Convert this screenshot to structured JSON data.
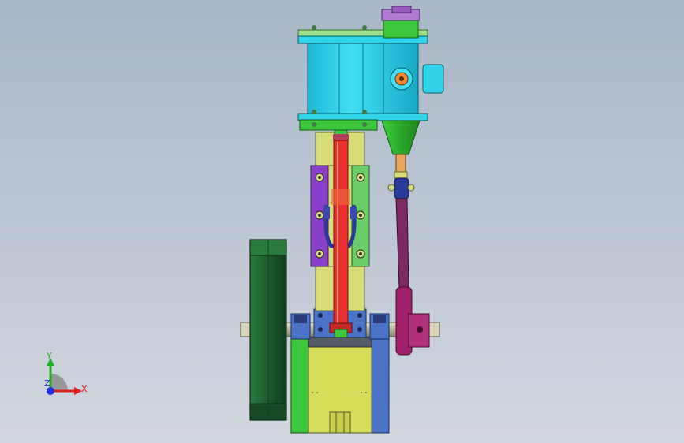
{
  "viewport": {
    "background_top": "#a9b7c8",
    "background_bottom": "#d3d8df"
  },
  "triad": {
    "x_label": "X",
    "y_label": "Y",
    "z_label": "Z",
    "x_color": "#e02020",
    "y_color": "#20b020",
    "z_color": "#2030e0"
  },
  "model": {
    "parts": [
      "cylinder-head",
      "cylinder-block",
      "steam-chest",
      "valve-cone",
      "piston-rod",
      "crosshead-guides",
      "connecting-rod",
      "eccentric-rod",
      "flywheel",
      "crankshaft",
      "eccentric",
      "bearing-blocks",
      "base-frame"
    ],
    "colors": {
      "cylinder": "#2fd3ea",
      "flange": "#9be08a",
      "green": "#3cc83c",
      "olive": "#d6dd78",
      "purple": "#8a3fc8",
      "red": "#e83030",
      "flywheel": "#1f5f2f",
      "magenta": "#a0206a",
      "blue": "#4b73c8"
    }
  }
}
